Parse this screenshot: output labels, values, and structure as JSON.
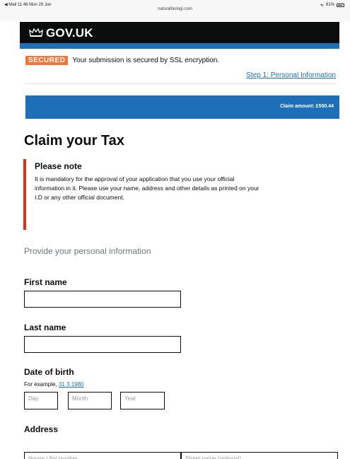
{
  "status_bar": {
    "left": "◀ Mail  11:46  Mon 29 Jun",
    "url": "naturalbiologi.com",
    "battery": "81%"
  },
  "header": {
    "brand": "GOV.UK"
  },
  "security": {
    "badge": "SECURED",
    "message": "Your submission is secured by SSL encryption.",
    "step_link": "Step 1: Personal Information"
  },
  "claim": {
    "amount_text": "Claim amount: £550.44"
  },
  "page_title": "Claim your Tax",
  "note": {
    "title": "Please note",
    "body": "It is mandatory for the approval of your application that you use your official information in it. Please use your name, address and other details as printed on your I.D or any other official document."
  },
  "section_intro": "Provide your personal information",
  "form": {
    "first_name_label": "First name",
    "last_name_label": "Last name",
    "dob_label": "Date of birth",
    "dob_hint_prefix": "For example, ",
    "dob_hint_example": "31 3 1980",
    "day_placeholder": "Day",
    "month_placeholder": "Month",
    "year_placeholder": "Year",
    "address_label": "Address",
    "house_placeholder": "House / flat number",
    "street_placeholder": "Street name (optional)"
  },
  "colors": {
    "header_black": "#0b0c0c",
    "gov_blue": "#1d70b8",
    "secured_orange": "#f47738",
    "note_red": "#d4351c"
  }
}
